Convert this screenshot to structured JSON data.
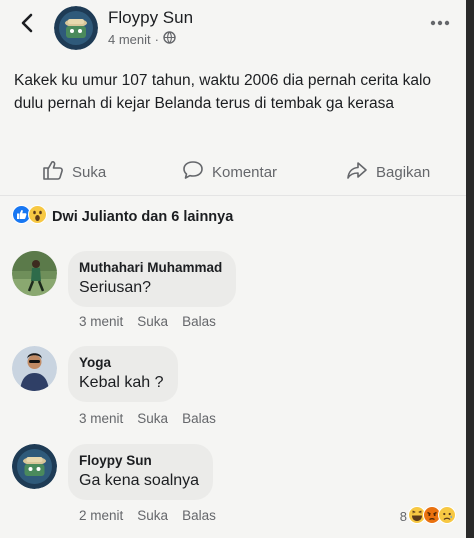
{
  "header": {
    "poster_name": "Floypy Sun",
    "time": "4 menit",
    "separator": "·",
    "icons": {
      "back": "back-arrow-icon",
      "privacy": "globe-icon",
      "more": "more-options-icon"
    }
  },
  "post": {
    "text": "Kakek ku umur 107 tahun, waktu 2006 dia pernah cerita kalo dulu pernah di kejar Belanda terus di tembak ga kerasa"
  },
  "actions": {
    "like": "Suka",
    "comment": "Komentar",
    "share": "Bagikan"
  },
  "reactions_summary": {
    "text": "Dwi Julianto dan 6 lainnya",
    "icons": [
      "like-reaction-icon",
      "wow-reaction-icon"
    ]
  },
  "comments": [
    {
      "name": "Muthahari Muhammad",
      "text": "Seriusan?",
      "time": "3 menit",
      "like_label": "Suka",
      "reply_label": "Balas"
    },
    {
      "name": "Yoga",
      "text": "Kebal kah ?",
      "time": "3 menit",
      "like_label": "Suka",
      "reply_label": "Balas"
    },
    {
      "name": "Floypy Sun",
      "text": "Ga kena soalnya",
      "time": "2 menit",
      "like_label": "Suka",
      "reply_label": "Balas",
      "reaction_count": "8",
      "reaction_icons": [
        "haha-reaction-icon",
        "angry-reaction-icon",
        "sad-reaction-icon"
      ]
    }
  ],
  "colors": {
    "background": "#f5f5f3",
    "bubble": "#ebebe9",
    "secondary_text": "#65676b",
    "like_blue": "#1877f2"
  }
}
